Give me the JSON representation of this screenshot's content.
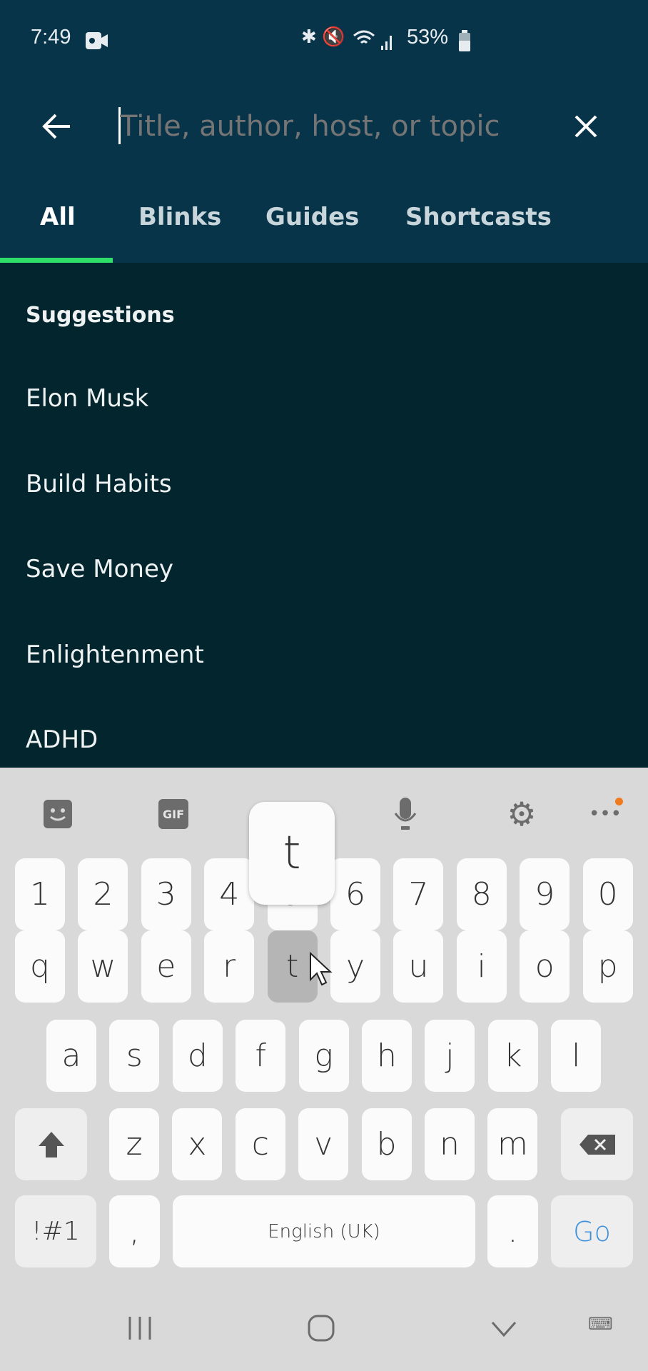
{
  "status_bar": {
    "time": "7:49",
    "battery": "53%",
    "icons": [
      "video-record-icon",
      "bluetooth-icon",
      "mute-icon",
      "wifi-icon",
      "signal-icon",
      "battery-icon"
    ]
  },
  "search": {
    "placeholder": "Title, author, host, or topic",
    "value": ""
  },
  "tabs": [
    {
      "label": "All",
      "active": true
    },
    {
      "label": "Blinks"
    },
    {
      "label": "Guides"
    },
    {
      "label": "Shortcasts"
    }
  ],
  "colors": {
    "header": "#08344a",
    "content": "#03252d",
    "tab_indicator": "#2ee06a",
    "go_key": "#3d8fd9"
  },
  "suggestions": {
    "title": "Suggestions",
    "items": [
      "Elon Musk",
      "Build Habits",
      "Save Money",
      "Enlightenment",
      "ADHD"
    ]
  },
  "keyboard": {
    "toolbar": [
      "sticker-icon",
      "gif-icon",
      "emoji-icon",
      "microphone-icon",
      "settings-icon",
      "more-icon"
    ],
    "gif_label": "GIF",
    "popup_key": "t",
    "pressed_key": "t",
    "rows": [
      [
        "1",
        "2",
        "3",
        "4",
        "5",
        "6",
        "7",
        "8",
        "9",
        "0"
      ],
      [
        "q",
        "w",
        "e",
        "r",
        "t",
        "y",
        "u",
        "i",
        "o",
        "p"
      ],
      [
        "a",
        "s",
        "d",
        "f",
        "g",
        "h",
        "j",
        "k",
        "l"
      ],
      [
        "z",
        "x",
        "c",
        "v",
        "b",
        "n",
        "m"
      ]
    ],
    "symbols_label": "!#1",
    "comma": ",",
    "space_label": "English (UK)",
    "period": ".",
    "go_label": "Go"
  }
}
